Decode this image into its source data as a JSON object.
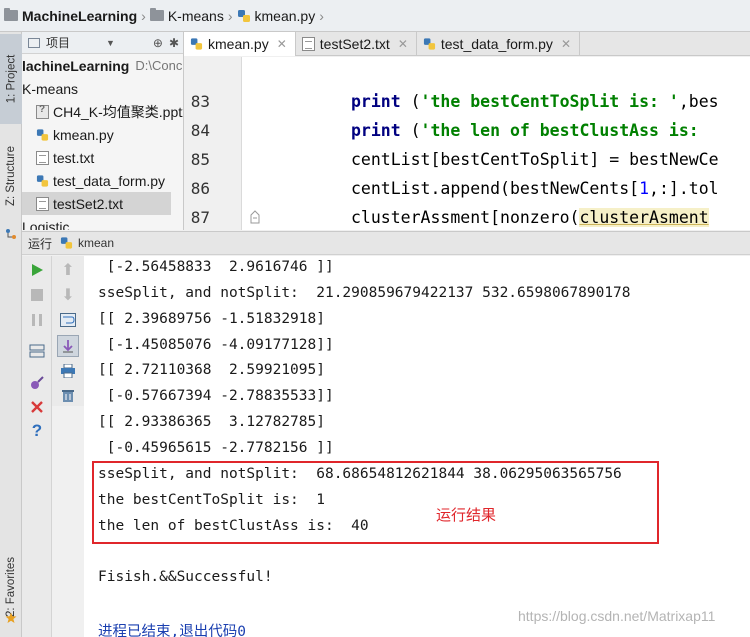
{
  "breadcrumb": [
    "MachineLearning",
    "K-means",
    "kmean.py"
  ],
  "sidebar_tabs": {
    "project": "1: Project",
    "structure": "Z: Structure",
    "favorites": "2: Favorites"
  },
  "project_panel": {
    "title": "项目",
    "items": [
      {
        "label": "lachineLearning",
        "path": "D:\\Conc"
      },
      {
        "label": "K-means"
      },
      {
        "label": "CH4_K-均值聚类.pptx"
      },
      {
        "label": "kmean.py"
      },
      {
        "label": "test.txt"
      },
      {
        "label": "test_data_form.py"
      },
      {
        "label": "testSet2.txt"
      },
      {
        "label": "Logistic"
      }
    ]
  },
  "editor_tabs": [
    {
      "label": "kmean.py",
      "active": true
    },
    {
      "label": "testSet2.txt",
      "active": false
    },
    {
      "label": "test_data_form.py",
      "active": false
    }
  ],
  "code": {
    "line_numbers": [
      "83",
      "84",
      "85",
      "86",
      "87"
    ],
    "l83": {
      "kw": "print",
      "open": " (",
      "str": "'the bestCentToSplit is: '",
      "rest": ",bes"
    },
    "l84": {
      "kw": "print",
      "open": " (",
      "str": "'the len of bestClustAss is: "
    },
    "l85": {
      "text": "centList[bestCentToSplit] = bestNewCe"
    },
    "l86": {
      "pre": "centList.append(bestNewCents[",
      "num": "1",
      "post": ",:].tol"
    },
    "l87": {
      "pre": "clusterAssment[nonzero(",
      "hl": "clusterAsment"
    }
  },
  "run": {
    "label": "运行",
    "config": "kmean"
  },
  "console": {
    "lines": [
      " [-2.56458833  2.9616746 ]]",
      "sseSplit, and notSplit:  21.290859679422137 532.6598067890178",
      "[[ 2.39689756 -1.51832918]",
      " [-1.45085076 -4.09177128]]",
      "[[ 2.72110368  2.59921095]",
      " [-0.57667394 -2.78835533]]",
      "[[ 2.93386365  3.12782785]",
      " [-0.45965615 -2.7782156 ]]",
      "sseSplit, and notSplit:  68.68654812621844 38.06295063565756",
      "the bestCentToSplit is:  1",
      "the len of bestClustAss is:  40",
      "Fisish.&&Successful!",
      "进程已结束,退出代码0"
    ],
    "annotation": "运行结果",
    "watermark": "https://blog.csdn.net/Matrixap11"
  },
  "colors": {
    "highlight_box": "#e0262b",
    "keyword": "#000080",
    "string": "#008000"
  }
}
